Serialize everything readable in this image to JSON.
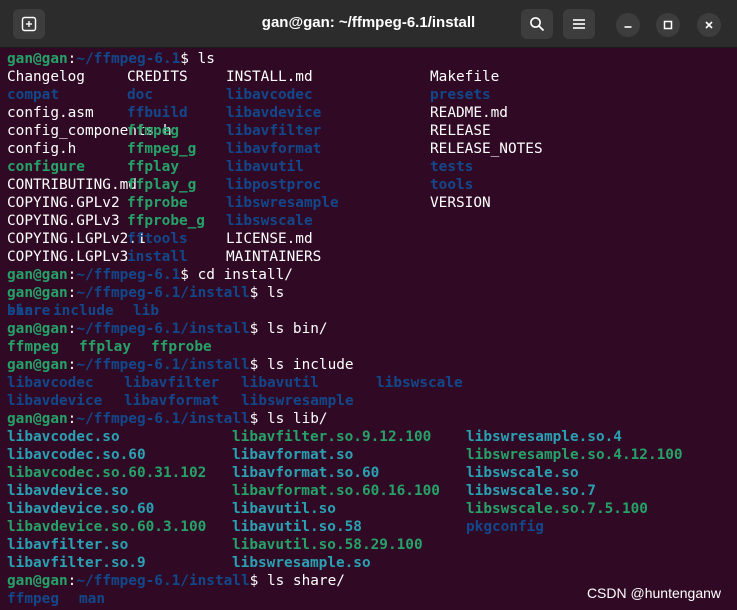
{
  "window": {
    "title": "gan@gan: ~/ffmpeg-6.1/install",
    "new_tab_icon": "new-tab-icon",
    "search_icon": "search-icon",
    "menu_icon": "hamburger-menu-icon",
    "minimize_icon": "minimize-icon",
    "maximize_icon": "maximize-icon",
    "close_icon": "close-icon"
  },
  "colors": {
    "background": "#300a24",
    "titlebar": "#2c2c2c",
    "prompt_user": "#26a269",
    "prompt_path": "#12488b",
    "directory": "#12488b",
    "executable": "#26a269",
    "symlink": "#2aa1b3",
    "file": "#ffffff"
  },
  "terminal": {
    "lines": [
      {
        "prompt": {
          "user": "gan@gan",
          "path": "~/ffmpeg-6.1"
        },
        "command": "ls"
      },
      {
        "cols": [
          120,
          219,
          423
        ],
        "cells": [
          [
            "Changelog",
            "file"
          ],
          [
            "CREDITS",
            "file"
          ],
          [
            "INSTALL.md",
            "file"
          ],
          [
            "Makefile",
            "file"
          ]
        ]
      },
      {
        "cols": [
          120,
          219,
          423
        ],
        "cells": [
          [
            "compat",
            "dir"
          ],
          [
            "doc",
            "dir"
          ],
          [
            "libavcodec",
            "dir"
          ],
          [
            "presets",
            "dir"
          ]
        ]
      },
      {
        "cols": [
          120,
          219,
          423
        ],
        "cells": [
          [
            "config.asm",
            "file"
          ],
          [
            "ffbuild",
            "dir"
          ],
          [
            "libavdevice",
            "dir"
          ],
          [
            "README.md",
            "file"
          ]
        ]
      },
      {
        "cols": [
          120,
          219,
          423
        ],
        "cells": [
          [
            "config_components.h",
            "file"
          ],
          [
            "ffmpeg",
            "exe"
          ],
          [
            "libavfilter",
            "dir"
          ],
          [
            "RELEASE",
            "file"
          ]
        ]
      },
      {
        "cols": [
          120,
          219,
          423
        ],
        "cells": [
          [
            "config.h",
            "file"
          ],
          [
            "ffmpeg_g",
            "exe"
          ],
          [
            "libavformat",
            "dir"
          ],
          [
            "RELEASE_NOTES",
            "file"
          ]
        ]
      },
      {
        "cols": [
          120,
          219,
          423
        ],
        "cells": [
          [
            "configure",
            "exe"
          ],
          [
            "ffplay",
            "exe"
          ],
          [
            "libavutil",
            "dir"
          ],
          [
            "tests",
            "dir"
          ]
        ]
      },
      {
        "cols": [
          120,
          219,
          423
        ],
        "cells": [
          [
            "CONTRIBUTING.md",
            "file"
          ],
          [
            "ffplay_g",
            "exe"
          ],
          [
            "libpostproc",
            "dir"
          ],
          [
            "tools",
            "dir"
          ]
        ]
      },
      {
        "cols": [
          120,
          219,
          423
        ],
        "cells": [
          [
            "COPYING.GPLv2",
            "file"
          ],
          [
            "ffprobe",
            "exe"
          ],
          [
            "libswresample",
            "dir"
          ],
          [
            "VERSION",
            "file"
          ]
        ]
      },
      {
        "cols": [
          120,
          219
        ],
        "cells": [
          [
            "COPYING.GPLv3",
            "file"
          ],
          [
            "ffprobe_g",
            "exe"
          ],
          [
            "libswscale",
            "dir"
          ]
        ]
      },
      {
        "cols": [
          120,
          219
        ],
        "cells": [
          [
            "COPYING.LGPLv2.1",
            "file"
          ],
          [
            "fftools",
            "dir"
          ],
          [
            "LICENSE.md",
            "file"
          ]
        ]
      },
      {
        "cols": [
          120,
          219
        ],
        "cells": [
          [
            "COPYING.LGPLv3",
            "file"
          ],
          [
            "install",
            "dir"
          ],
          [
            "MAINTAINERS",
            "file"
          ]
        ]
      },
      {
        "prompt": {
          "user": "gan@gan",
          "path": "~/ffmpeg-6.1"
        },
        "command": "cd install/"
      },
      {
        "prompt": {
          "user": "gan@gan",
          "path": "~/ffmpeg-6.1/install"
        },
        "command": "ls"
      },
      {
        "cols": [
          46,
          126
        ],
        "cells": [
          [
            "bin",
            "dir"
          ],
          [
            "include",
            "dir"
          ],
          [
            "lib",
            "dir"
          ],
          [
            "share",
            "dir"
          ]
        ]
      },
      {
        "prompt": {
          "user": "gan@gan",
          "path": "~/ffmpeg-6.1/install"
        },
        "command": "ls bin/"
      },
      {
        "cols": [
          72,
          144
        ],
        "cells": [
          [
            "ffmpeg",
            "exe"
          ],
          [
            "ffplay",
            "exe"
          ],
          [
            "ffprobe",
            "exe"
          ]
        ]
      },
      {
        "prompt": {
          "user": "gan@gan",
          "path": "~/ffmpeg-6.1/install"
        },
        "command": "ls include"
      },
      {
        "cols": [
          117,
          234,
          369
        ],
        "cells": [
          [
            "libavcodec",
            "dir"
          ],
          [
            "libavfilter",
            "dir"
          ],
          [
            "libavutil",
            "dir"
          ],
          [
            "libswscale",
            "dir"
          ]
        ]
      },
      {
        "cols": [
          117,
          234
        ],
        "cells": [
          [
            "libavdevice",
            "dir"
          ],
          [
            "libavformat",
            "dir"
          ],
          [
            "libswresample",
            "dir"
          ]
        ]
      },
      {
        "prompt": {
          "user": "gan@gan",
          "path": "~/ffmpeg-6.1/install"
        },
        "command": "ls lib/"
      },
      {
        "cols": [
          225,
          459
        ],
        "cells": [
          [
            "libavcodec.so",
            "lnk"
          ],
          [
            "libavfilter.so.9.12.100",
            "exe"
          ],
          [
            "libswresample.so.4",
            "lnk"
          ]
        ]
      },
      {
        "cols": [
          225,
          459
        ],
        "cells": [
          [
            "libavcodec.so.60",
            "lnk"
          ],
          [
            "libavformat.so",
            "lnk"
          ],
          [
            "libswresample.so.4.12.100",
            "exe"
          ]
        ]
      },
      {
        "cols": [
          225,
          459
        ],
        "cells": [
          [
            "libavcodec.so.60.31.102",
            "exe"
          ],
          [
            "libavformat.so.60",
            "lnk"
          ],
          [
            "libswscale.so",
            "lnk"
          ]
        ]
      },
      {
        "cols": [
          225,
          459
        ],
        "cells": [
          [
            "libavdevice.so",
            "lnk"
          ],
          [
            "libavformat.so.60.16.100",
            "exe"
          ],
          [
            "libswscale.so.7",
            "lnk"
          ]
        ]
      },
      {
        "cols": [
          225,
          459
        ],
        "cells": [
          [
            "libavdevice.so.60",
            "lnk"
          ],
          [
            "libavutil.so",
            "lnk"
          ],
          [
            "libswscale.so.7.5.100",
            "exe"
          ]
        ]
      },
      {
        "cols": [
          225,
          459
        ],
        "cells": [
          [
            "libavdevice.so.60.3.100",
            "exe"
          ],
          [
            "libavutil.so.58",
            "lnk"
          ],
          [
            "pkgconfig",
            "dir"
          ]
        ]
      },
      {
        "cols": [
          225
        ],
        "cells": [
          [
            "libavfilter.so",
            "lnk"
          ],
          [
            "libavutil.so.58.29.100",
            "exe"
          ]
        ]
      },
      {
        "cols": [
          225
        ],
        "cells": [
          [
            "libavfilter.so.9",
            "lnk"
          ],
          [
            "libswresample.so",
            "lnk"
          ]
        ]
      },
      {
        "prompt": {
          "user": "gan@gan",
          "path": "~/ffmpeg-6.1/install"
        },
        "command": "ls share/"
      },
      {
        "cols": [
          72
        ],
        "cells": [
          [
            "ffmpeg",
            "dir"
          ],
          [
            "man",
            "dir"
          ]
        ]
      }
    ]
  },
  "watermark": "CSDN @huntenganw"
}
